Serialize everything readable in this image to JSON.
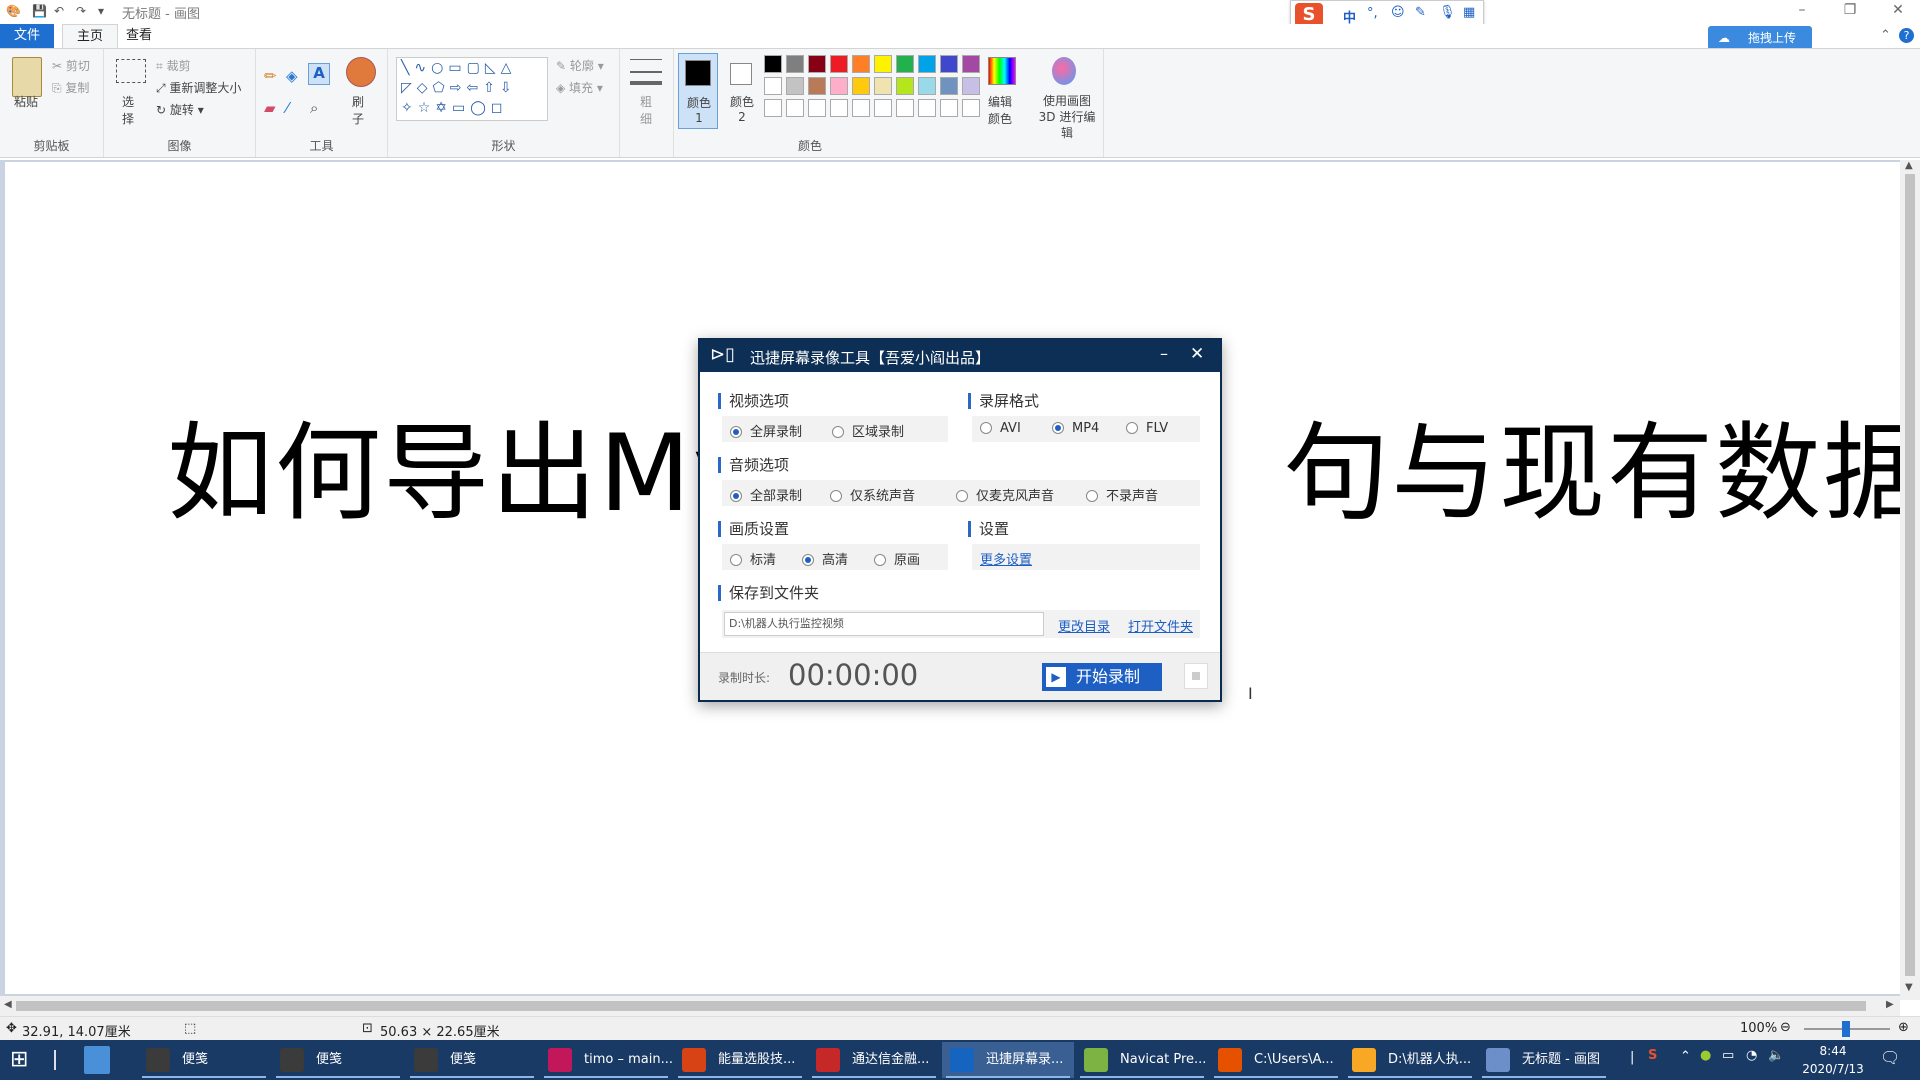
{
  "window": {
    "title": "无标题 - 画图"
  },
  "menu": {
    "file": "文件",
    "home": "主页",
    "view": "查看"
  },
  "ribbon": {
    "clipboard": {
      "paste": "粘贴",
      "cut": "剪切",
      "copy": "复制",
      "label": "剪贴板"
    },
    "image": {
      "select": "选择",
      "crop": "裁剪",
      "resize": "重新调整大小",
      "rotate": "旋转",
      "label": "图像"
    },
    "tools": {
      "label": "工具"
    },
    "brushes": {
      "label": "刷子"
    },
    "shapes": {
      "outline": "轮廓",
      "fill": "填充",
      "label": "形状"
    },
    "size": {
      "label": "粗细"
    },
    "colors": {
      "color1": "颜色 1",
      "color2": "颜色 2",
      "edit": "编辑颜色",
      "paint3d": "使用画图 3D 进行编辑",
      "label": "颜色",
      "palette_row1": [
        "#000000",
        "#7f7f7f",
        "#880015",
        "#ed1c24",
        "#ff7f27",
        "#fff200",
        "#22b14c",
        "#00a2e8",
        "#3f48cc",
        "#a349a4"
      ],
      "palette_row2": [
        "#ffffff",
        "#c3c3c3",
        "#b97a57",
        "#ffaec9",
        "#ffc90e",
        "#efe4b0",
        "#b5e61d",
        "#99d9ea",
        "#7092be",
        "#c8bfe7"
      ]
    }
  },
  "ime": {
    "mode": "中"
  },
  "cloud_upload": "拖拽上传",
  "canvas": {
    "text_left": "如何导出My",
    "text_right": "句与现有数据"
  },
  "dialog": {
    "title": "迅捷屏幕录像工具【吾爱小阎出品】",
    "video_section": "视频选项",
    "video_opts": [
      "全屏录制",
      "区域录制"
    ],
    "format_section": "录屏格式",
    "format_opts": [
      "AVI",
      "MP4",
      "FLV"
    ],
    "audio_section": "音频选项",
    "audio_opts": [
      "全部录制",
      "仅系统声音",
      "仅麦克风声音",
      "不录声音"
    ],
    "quality_section": "画质设置",
    "quality_opts": [
      "标清",
      "高清",
      "原画"
    ],
    "settings_section": "设置",
    "more_settings": "更多设置",
    "save_section": "保存到文件夹",
    "save_path": "D:\\机器人执行监控视频",
    "change_dir": "更改目录",
    "open_folder": "打开文件夹",
    "duration_label": "录制时长:",
    "duration": "00:00:00",
    "start": "开始录制"
  },
  "status": {
    "cursor": "32.91, 14.07厘米",
    "size": "50.63 × 22.65厘米",
    "zoom": "100%"
  },
  "taskbar": {
    "tasks": [
      {
        "label": "便笺",
        "color": "#3b3b3b"
      },
      {
        "label": "便笺",
        "color": "#3b3b3b"
      },
      {
        "label": "便笺",
        "color": "#3b3b3b"
      },
      {
        "label": "timo – main...",
        "color": "#c2185b"
      },
      {
        "label": "能量选股技...",
        "color": "#d84315"
      },
      {
        "label": "通达信金融...",
        "color": "#c62828"
      },
      {
        "label": "迅捷屏幕录...",
        "color": "#1565c0"
      },
      {
        "label": "Navicat Pre...",
        "color": "#7cb342"
      },
      {
        "label": "C:\\Users\\A...",
        "color": "#e65100"
      },
      {
        "label": "D:\\机器人执...",
        "color": "#f9a825"
      },
      {
        "label": "无标题 - 画图",
        "color": "#6d8fc9"
      }
    ],
    "time": "8:44",
    "date": "2020/7/13"
  }
}
